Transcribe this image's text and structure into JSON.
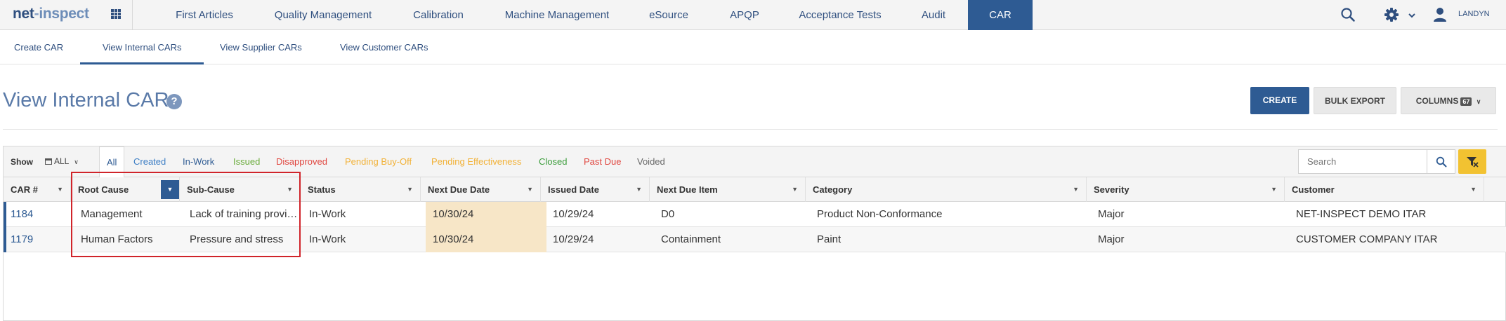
{
  "topnav": {
    "logo": {
      "part1": "net",
      "part2": "-",
      "part3": "inspect"
    },
    "items": [
      {
        "label": "First Articles"
      },
      {
        "label": "Quality Management"
      },
      {
        "label": "Calibration"
      },
      {
        "label": "Machine Management"
      },
      {
        "label": "eSource"
      },
      {
        "label": "APQP"
      },
      {
        "label": "Acceptance Tests"
      },
      {
        "label": "Audit"
      },
      {
        "label": "CAR"
      }
    ],
    "active_item": "CAR",
    "user": "LANDYN"
  },
  "subnav": {
    "items": [
      {
        "label": "Create CAR"
      },
      {
        "label": "View Internal CARs"
      },
      {
        "label": "View Supplier CARs"
      },
      {
        "label": "View Customer CARs"
      }
    ],
    "active_item": "View Internal CARs"
  },
  "page": {
    "title": "View Internal CARs",
    "help": "?",
    "buttons": {
      "create": "CREATE",
      "bulk_export": "BULK EXPORT",
      "columns": "COLUMNS",
      "columns_count": "67"
    }
  },
  "toolbar": {
    "show_label": "Show",
    "show_value": "ALL",
    "filters": [
      {
        "label": "All",
        "color": "#2e5b93"
      },
      {
        "label": "Created",
        "color": "#3b7dc4"
      },
      {
        "label": "In-Work",
        "color": "#2e5b93"
      },
      {
        "label": "Issued",
        "color": "#6aab3b"
      },
      {
        "label": "Disapproved",
        "color": "#e0463f"
      },
      {
        "label": "Pending Buy-Off",
        "color": "#f2b136"
      },
      {
        "label": "Pending Effectiveness",
        "color": "#f2b136"
      },
      {
        "label": "Closed",
        "color": "#3a9c3a"
      },
      {
        "label": "Past Due",
        "color": "#e0463f"
      },
      {
        "label": "Voided",
        "color": "#666666"
      }
    ],
    "active_filter": "All",
    "search_placeholder": "Search"
  },
  "table": {
    "columns": [
      "CAR #",
      "Root Cause",
      "Sub-Cause",
      "Status",
      "Next Due Date",
      "Issued Date",
      "Next Due Item",
      "Category",
      "Severity",
      "Customer"
    ],
    "rows": [
      [
        "1184",
        "Management",
        "Lack of training provis...",
        "In-Work",
        "10/30/24",
        "10/29/24",
        "D0",
        "Product Non-Conformance",
        "Major",
        "NET-INSPECT DEMO ITAR"
      ],
      [
        "1179",
        "Human Factors",
        "Pressure and stress",
        "In-Work",
        "10/30/24",
        "10/29/24",
        "Containment",
        "Paint",
        "Major",
        "CUSTOMER COMPANY ITAR"
      ]
    ]
  },
  "colors": {
    "brand": "#2e5b93",
    "highlight": "#d0242a",
    "due_date_bg": "#f7e6c7",
    "clear_filter": "#f2c231"
  }
}
